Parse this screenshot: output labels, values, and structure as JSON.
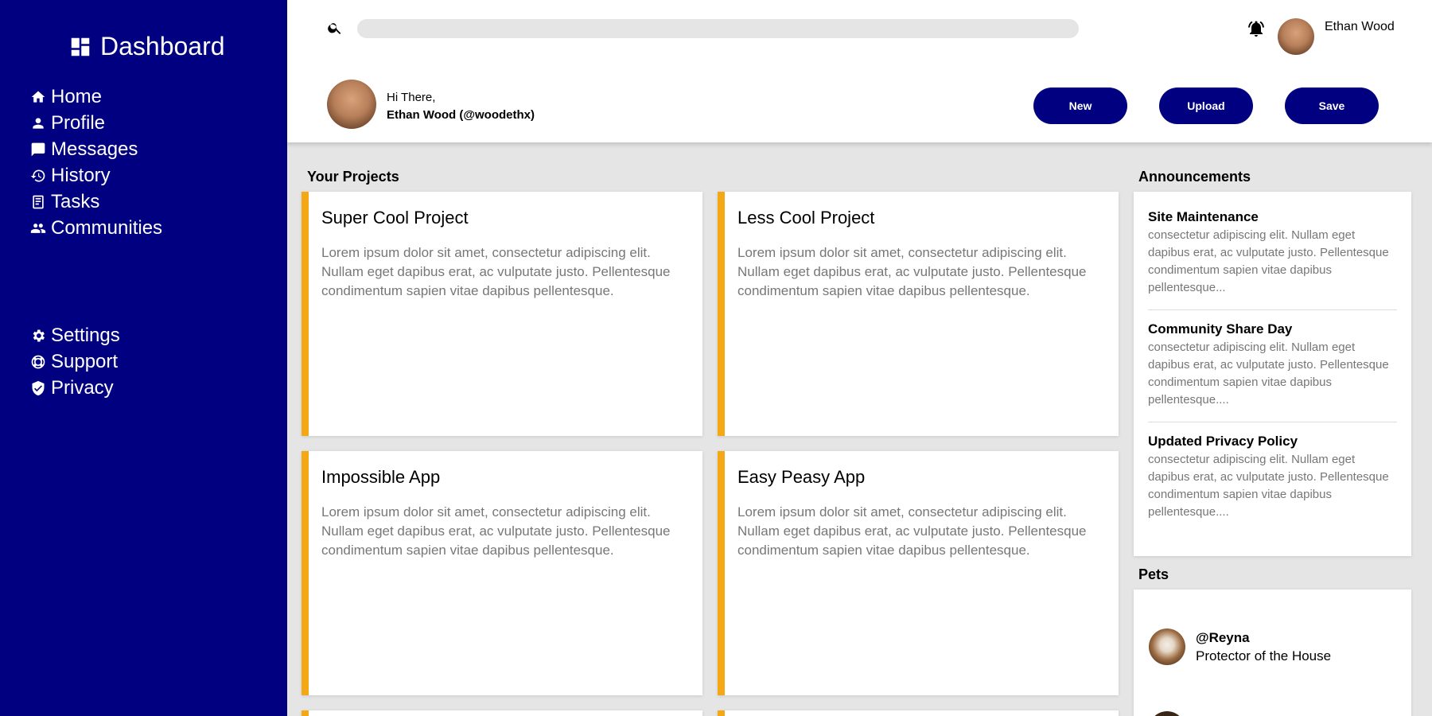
{
  "sidebar": {
    "brand": "Dashboard",
    "primary": [
      {
        "label": "Home",
        "icon": "home-icon"
      },
      {
        "label": "Profile",
        "icon": "person-icon"
      },
      {
        "label": "Messages",
        "icon": "message-icon"
      },
      {
        "label": "History",
        "icon": "history-icon"
      },
      {
        "label": "Tasks",
        "icon": "tasks-icon"
      },
      {
        "label": "Communities",
        "icon": "group-icon"
      }
    ],
    "secondary": [
      {
        "label": "Settings",
        "icon": "gear-icon"
      },
      {
        "label": "Support",
        "icon": "lifebuoy-icon"
      },
      {
        "label": "Privacy",
        "icon": "shield-icon"
      }
    ]
  },
  "header": {
    "search_placeholder": "",
    "username": "Ethan Wood",
    "greeting": "Hi There,",
    "full_name": "Ethan Wood (@woodethx)",
    "buttons": {
      "new": "New",
      "upload": "Upload",
      "save": "Save"
    }
  },
  "projects": {
    "title": "Your Projects",
    "items": [
      {
        "name": "Super Cool Project",
        "desc": "Lorem ipsum dolor sit amet, consectetur adipiscing elit. Nullam eget dapibus erat, ac vulputate justo. Pellentesque condimentum sapien vitae dapibus pellentesque."
      },
      {
        "name": "Less Cool Project",
        "desc": "Lorem ipsum dolor sit amet, consectetur adipiscing elit. Nullam eget dapibus erat, ac vulputate justo. Pellentesque condimentum sapien vitae dapibus pellentesque."
      },
      {
        "name": "Impossible App",
        "desc": "Lorem ipsum dolor sit amet, consectetur adipiscing elit. Nullam eget dapibus erat, ac vulputate justo. Pellentesque condimentum sapien vitae dapibus pellentesque."
      },
      {
        "name": "Easy Peasy App",
        "desc": "Lorem ipsum dolor sit amet, consectetur adipiscing elit. Nullam eget dapibus erat, ac vulputate justo. Pellentesque condimentum sapien vitae dapibus pellentesque."
      }
    ]
  },
  "announcements": {
    "title": "Announcements",
    "items": [
      {
        "title": "Site Maintenance",
        "body": "consectetur adipiscing elit. Nullam eget dapibus erat, ac vulputate justo. Pellentesque condimentum sapien vitae dapibus pellentesque..."
      },
      {
        "title": "Community Share Day",
        "body": "consectetur adipiscing elit. Nullam eget dapibus erat, ac vulputate justo. Pellentesque condimentum sapien vitae dapibus pellentesque...."
      },
      {
        "title": "Updated Privacy Policy",
        "body": "consectetur adipiscing elit. Nullam eget dapibus erat, ac vulputate justo. Pellentesque condimentum sapien vitae dapibus pellentesque...."
      }
    ]
  },
  "pets": {
    "title": "Pets",
    "items": [
      {
        "handle": "@Reyna",
        "role": "Protector of the House"
      }
    ]
  },
  "colors": {
    "sidebar": "#000080",
    "accent": "#f5a815",
    "background": "#e5e5e5"
  }
}
